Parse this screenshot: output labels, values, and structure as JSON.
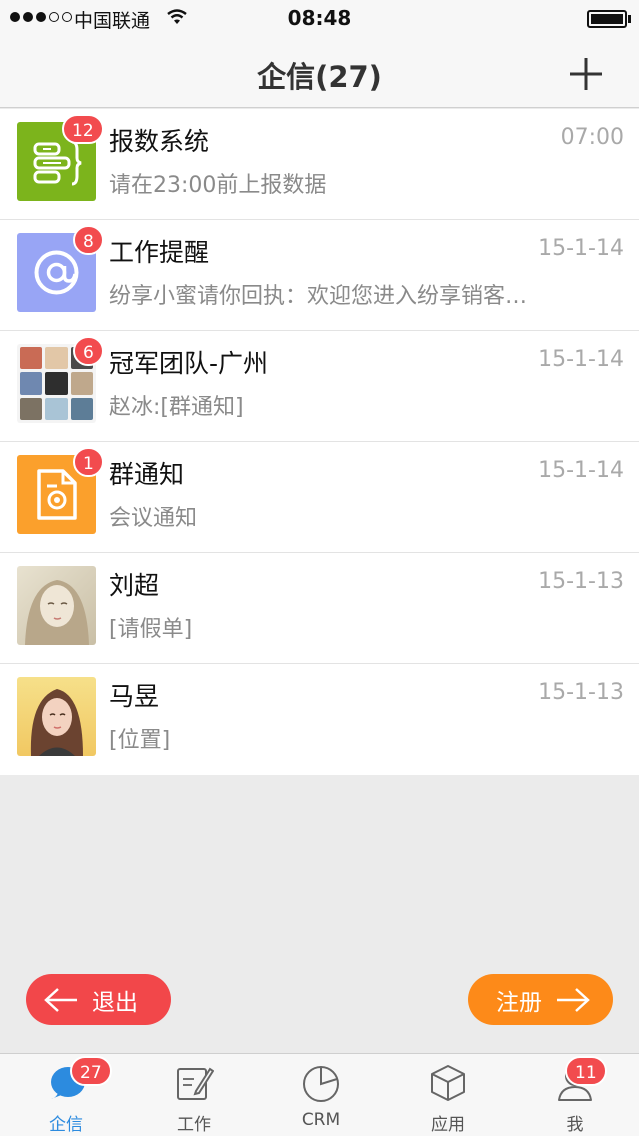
{
  "status_bar": {
    "carrier": "中国联通",
    "time": "08:48"
  },
  "nav": {
    "title": "企信(27)"
  },
  "conversations": [
    {
      "name": "报数系统",
      "time": "07:00",
      "preview": "请在23:00前上报数据",
      "badge": "12",
      "avatar": "report-system-icon",
      "color": "#7cb41c"
    },
    {
      "name": "工作提醒",
      "time": "15-1-14",
      "preview": "纷享小蜜请你回执：欢迎您进入纷享销客…",
      "badge": "8",
      "avatar": "at-sign-icon",
      "color": "#98a5f5"
    },
    {
      "name": "冠军团队-广州",
      "time": "15-1-14",
      "preview": "赵冰:[群通知]",
      "badge": "6",
      "avatar": "group-avatar"
    },
    {
      "name": "群通知",
      "time": "15-1-14",
      "preview": "会议通知",
      "badge": "1",
      "avatar": "notice-document-icon",
      "color": "#fba02c"
    },
    {
      "name": "刘超",
      "time": "15-1-13",
      "preview": "[请假单]",
      "badge": "",
      "avatar": "user-avatar-liuchao"
    },
    {
      "name": "马昱",
      "time": "15-1-13",
      "preview": "[位置]",
      "badge": "",
      "avatar": "user-avatar-mayu"
    }
  ],
  "buttons": {
    "exit": "退出",
    "register": "注册",
    "exit_color": "#f2474a",
    "register_color": "#fd8a19"
  },
  "tabs": [
    {
      "label": "企信",
      "badge": "27",
      "icon": "chat-bubble-icon",
      "active": true
    },
    {
      "label": "工作",
      "badge": "",
      "icon": "edit-note-icon"
    },
    {
      "label": "CRM",
      "badge": "",
      "icon": "pie-chart-icon"
    },
    {
      "label": "应用",
      "badge": "",
      "icon": "cube-icon"
    },
    {
      "label": "我",
      "badge": "11",
      "icon": "user-icon"
    }
  ],
  "colors": {
    "accent": "#2c8bdf",
    "badge": "#f24b4e"
  }
}
